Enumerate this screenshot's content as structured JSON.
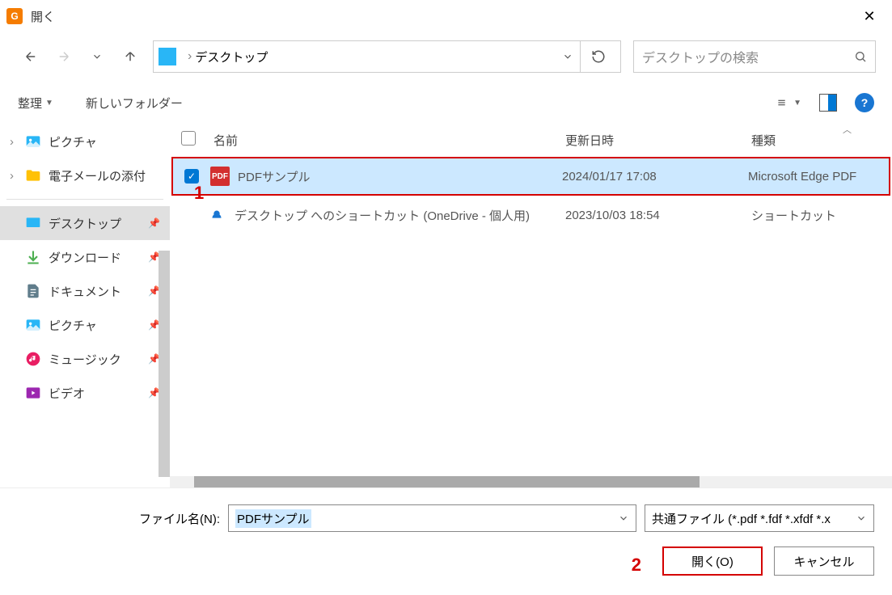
{
  "titlebar": {
    "app_icon_letter": "G",
    "title": "開く"
  },
  "nav": {
    "breadcrumb_location": "デスクトップ",
    "search_placeholder": "デスクトップの検索"
  },
  "toolbar": {
    "organize": "整理",
    "new_folder": "新しいフォルダー"
  },
  "tree": {
    "top_pictures": "ピクチャ",
    "top_email": "電子メールの添付",
    "desktop": "デスクトップ",
    "downloads": "ダウンロード",
    "documents": "ドキュメント",
    "pictures": "ピクチャ",
    "music": "ミュージック",
    "video": "ビデオ"
  },
  "columns": {
    "name": "名前",
    "date": "更新日時",
    "type": "種類"
  },
  "files": [
    {
      "name": "PDFサンプル",
      "date": "2024/01/17 17:08",
      "type": "Microsoft Edge PDF",
      "icon": "pdf",
      "selected": true
    },
    {
      "name": "デスクトップ へのショートカット (OneDrive - 個人用)",
      "date": "2023/10/03 18:54",
      "type": "ショートカット",
      "icon": "cloud",
      "selected": false
    }
  ],
  "footer": {
    "filename_label": "ファイル名(N):",
    "filename_value": "PDFサンプル",
    "filetype_value": "共通ファイル (*.pdf *.fdf *.xfdf *.x",
    "open_button": "開く(O)",
    "cancel_button": "キャンセル"
  },
  "annotations": {
    "one": "1",
    "two": "2"
  }
}
